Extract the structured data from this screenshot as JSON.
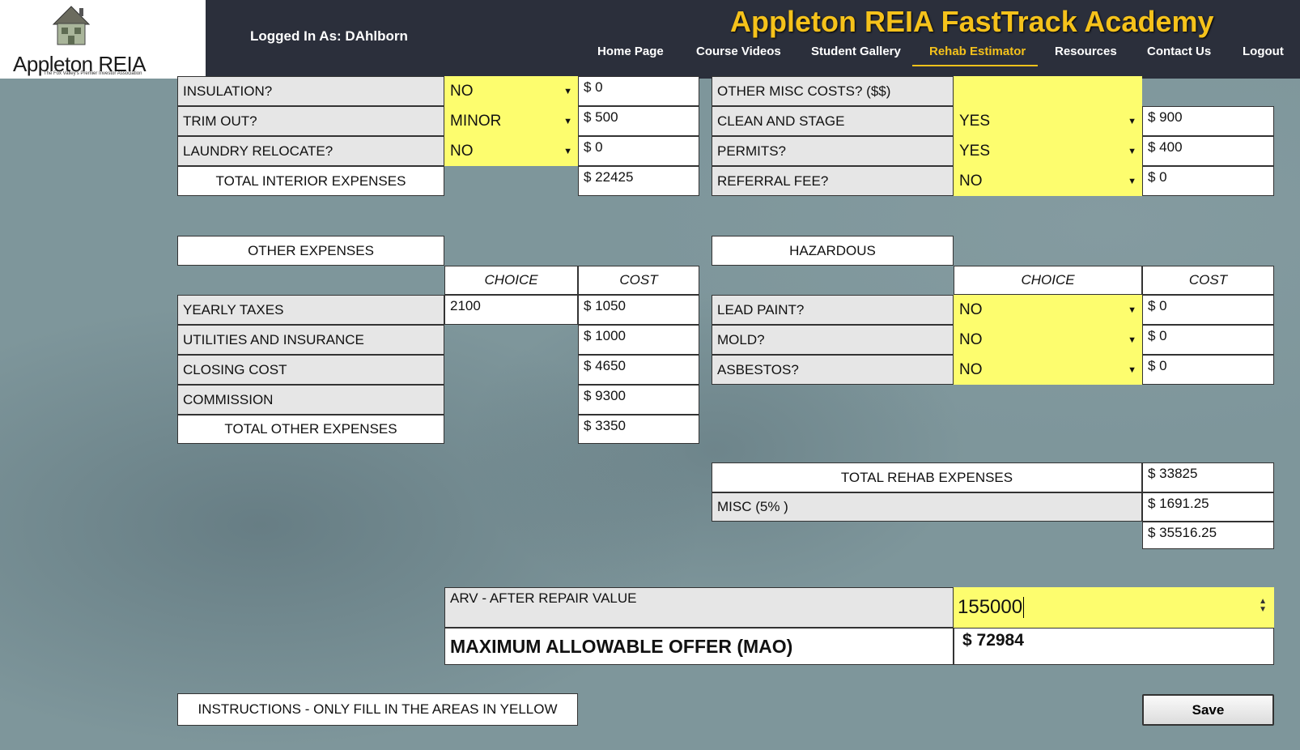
{
  "header": {
    "logo_text": "Appleton REIA",
    "logo_tagline": "The Fox Valley's Premier Investor Association",
    "logged_in": "Logged In As: DAhlborn",
    "site_title": "Appleton REIA FastTrack Academy",
    "accent": "#f5c21b",
    "nav": [
      {
        "label": "Home Page"
      },
      {
        "label": "Course Videos"
      },
      {
        "label": "Student Gallery"
      },
      {
        "label": "Rehab Estimator",
        "active": true
      },
      {
        "label": "Resources"
      },
      {
        "label": "Contact Us"
      },
      {
        "label": "Logout"
      }
    ]
  },
  "interior": {
    "rows": [
      {
        "label": "INSULATION?",
        "choice": "NO",
        "cost": "$ 0"
      },
      {
        "label": "TRIM OUT?",
        "choice": "MINOR",
        "cost": "$ 500"
      },
      {
        "label": "LAUNDRY RELOCATE?",
        "choice": "NO",
        "cost": "$ 0"
      }
    ],
    "total_label": "TOTAL INTERIOR EXPENSES",
    "total_cost": "$ 22425"
  },
  "misc": {
    "other_misc_label": "OTHER MISC COSTS? ($$)",
    "other_misc_value": "",
    "rows": [
      {
        "label": "CLEAN AND STAGE",
        "choice": "YES",
        "cost": "$ 900"
      },
      {
        "label": "PERMITS?",
        "choice": "YES",
        "cost": "$ 400"
      },
      {
        "label": "REFERRAL FEE?",
        "choice": "NO",
        "cost": "$ 0"
      }
    ]
  },
  "other_expenses": {
    "title": "OTHER EXPENSES",
    "choice_header": "CHOICE",
    "cost_header": "COST",
    "rows": [
      {
        "label": "YEARLY TAXES",
        "choice": "2100",
        "cost": "$ 1050"
      },
      {
        "label": "UTILITIES AND INSURANCE",
        "cost": "$ 1000"
      },
      {
        "label": "CLOSING COST",
        "cost": "$ 4650"
      },
      {
        "label": "COMMISSION",
        "cost": "$ 9300"
      }
    ],
    "total_label": "TOTAL OTHER EXPENSES",
    "total_cost": "$ 3350"
  },
  "hazardous": {
    "title": "HAZARDOUS",
    "choice_header": "CHOICE",
    "cost_header": "COST",
    "rows": [
      {
        "label": "LEAD PAINT?",
        "choice": "NO",
        "cost": "$ 0"
      },
      {
        "label": "MOLD?",
        "choice": "NO",
        "cost": "$ 0"
      },
      {
        "label": "ASBESTOS?",
        "choice": "NO",
        "cost": "$ 0"
      }
    ]
  },
  "totals": {
    "rehab_label": "TOTAL REHAB EXPENSES",
    "rehab_value": "$ 33825",
    "misc_label": "MISC (5% )",
    "misc_value": "$ 1691.25",
    "grand_total": "$ 35516.25"
  },
  "arv": {
    "label": "ARV - AFTER REPAIR VALUE",
    "value": "155000"
  },
  "mao": {
    "label": "MAXIMUM ALLOWABLE OFFER (MAO)",
    "value": "$ 72984"
  },
  "instructions": "INSTRUCTIONS - ONLY FILL IN THE AREAS IN YELLOW",
  "save_label": "Save",
  "colors": {
    "header_bg": "#2b2f3b",
    "input_yellow": "#fdfd6e",
    "label_gray": "#e6e6e6"
  }
}
